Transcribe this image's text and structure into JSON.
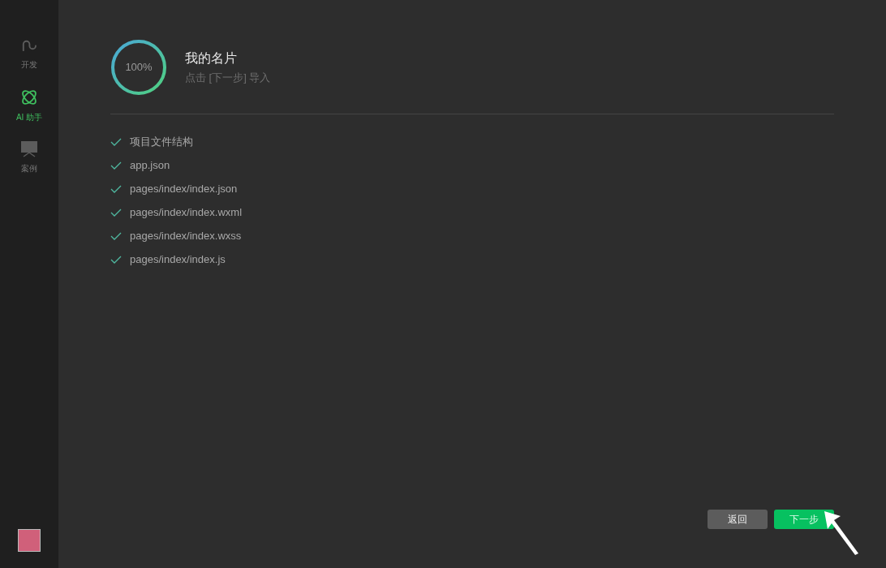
{
  "sidebar": {
    "items": [
      {
        "kind": "dev",
        "label": "开发",
        "selected": false
      },
      {
        "kind": "ai",
        "label": "AI 助手",
        "selected": true
      },
      {
        "kind": "cases",
        "label": "案例",
        "selected": false
      }
    ]
  },
  "progress": {
    "level": 1,
    "reading": "100%"
  },
  "title": "我的名片",
  "subtitle": "点击 [下一步] 导入",
  "files": [
    {
      "name": "项目文件结构",
      "done": true
    },
    {
      "name": "app.json",
      "done": true
    },
    {
      "name": "pages/index/index.json",
      "done": true
    },
    {
      "name": "pages/index/index.wxml",
      "done": true
    },
    {
      "name": "pages/index/index.wxss",
      "done": true
    },
    {
      "name": "pages/index/index.js",
      "done": true
    }
  ],
  "buttons": [
    {
      "label": "返回",
      "primary": false
    },
    {
      "label": "下一步",
      "primary": true
    }
  ]
}
